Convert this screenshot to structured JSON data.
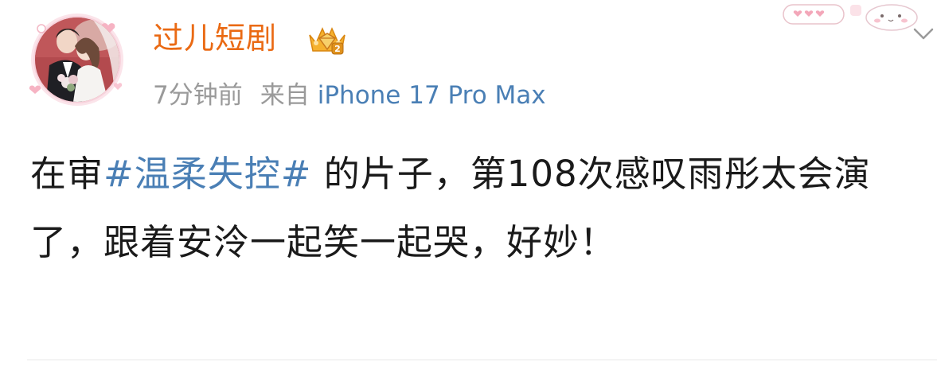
{
  "post": {
    "author": {
      "name": "过儿短剧",
      "avatar": "couple-photo",
      "badge_icon": "crown-diamond-icon"
    },
    "meta": {
      "time": "7分钟前",
      "source_prefix": "来自",
      "source_device": "iPhone 17 Pro Max"
    },
    "content": {
      "before": "在审",
      "hashtag": "#温柔失控#",
      "after": " 的片子，第108次感叹雨彤太会演了，跟着安泠一起笑一起哭，好妙！"
    }
  },
  "colors": {
    "username": "#ea6a14",
    "link": "#4a7fb5",
    "meta": "#9a9a9a",
    "text": "#1a1a1a"
  },
  "icons": {
    "more": "chevron-down-icon",
    "decoration": "pink-bubble-sticker"
  }
}
